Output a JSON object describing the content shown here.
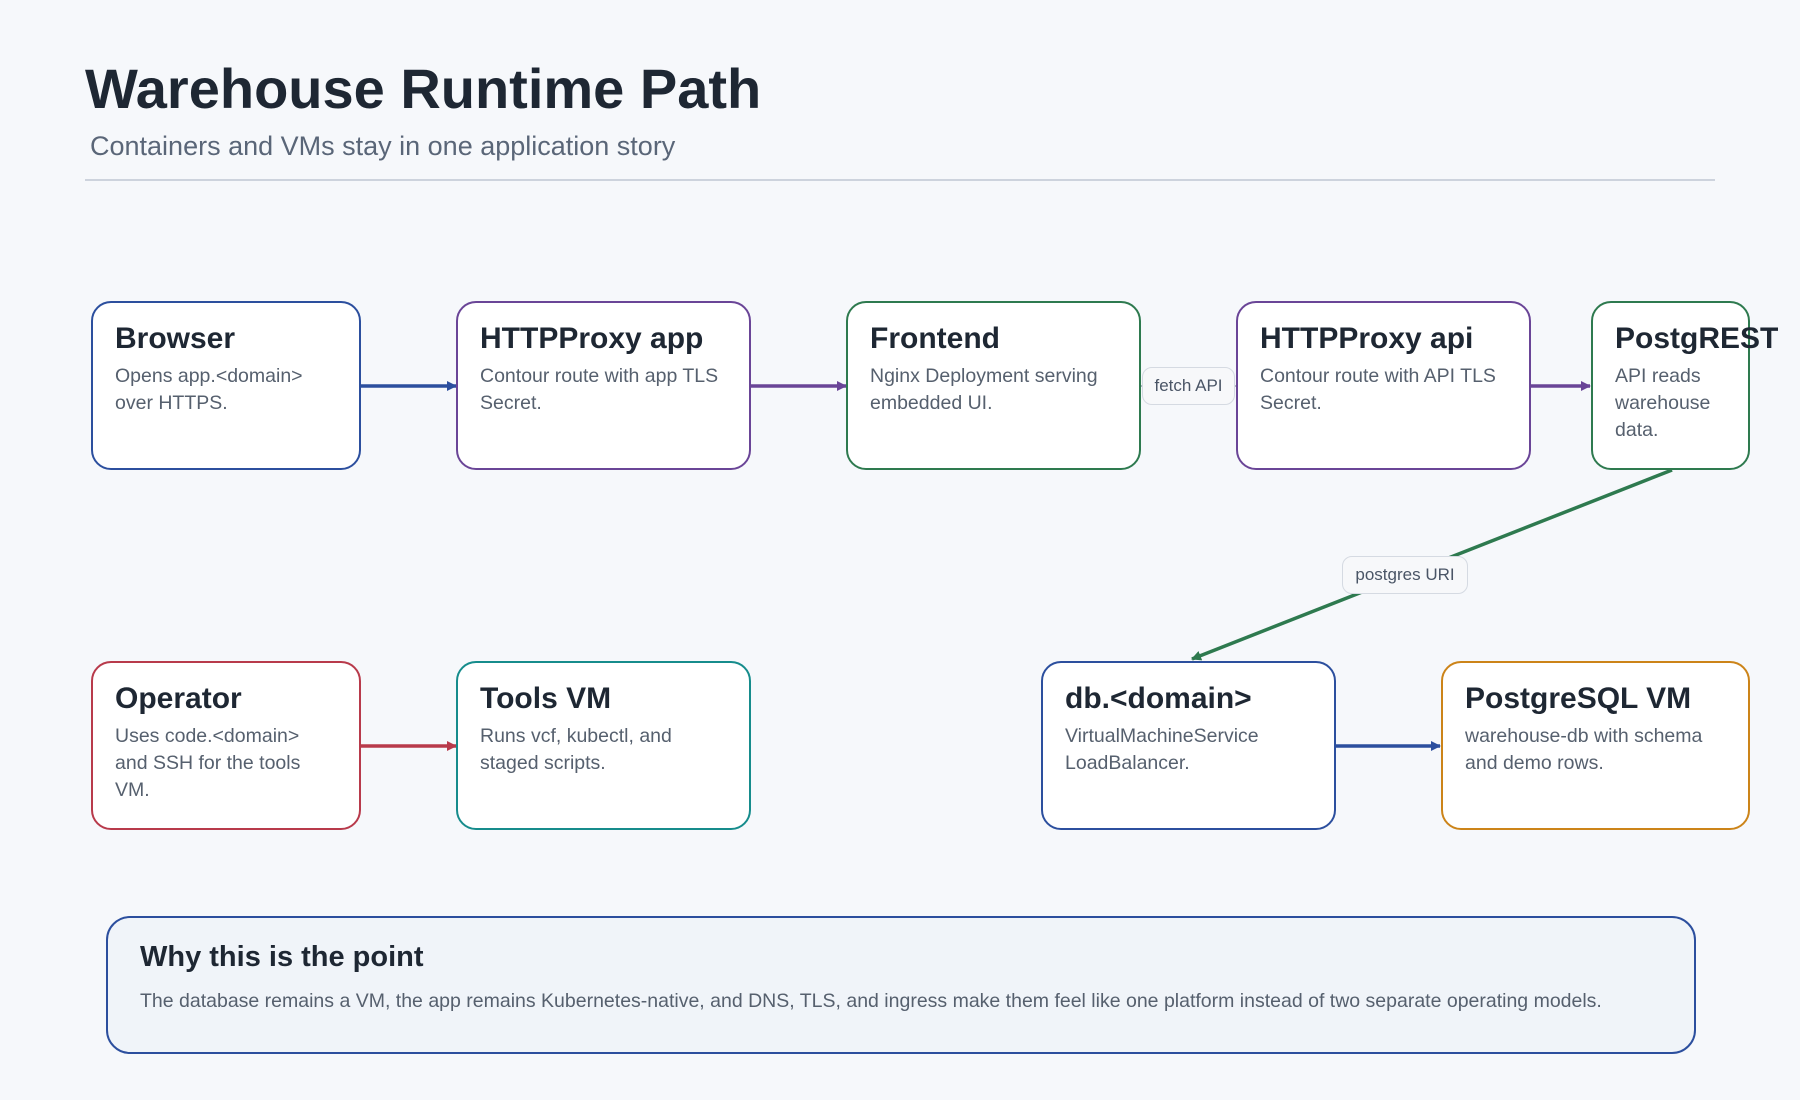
{
  "header": {
    "title": "Warehouse Runtime Path",
    "subtitle": "Containers and VMs stay in one application story"
  },
  "nodes": {
    "browser": {
      "title": "Browser",
      "desc": "Opens app.<domain> over HTTPS.",
      "color": "#2c4f9e"
    },
    "httpproxy_app": {
      "title": "HTTPProxy app",
      "desc": "Contour route with app TLS Secret.",
      "color": "#6a4597"
    },
    "frontend": {
      "title": "Frontend",
      "desc": "Nginx Deployment serving embedded UI.",
      "color": "#2e7a4f"
    },
    "httpproxy_api": {
      "title": "HTTPProxy api",
      "desc": "Contour route with API TLS Secret.",
      "color": "#6a4597"
    },
    "postgrest": {
      "title": "PostgREST",
      "desc": "API reads warehouse data.",
      "color": "#2e7a4f"
    },
    "operator": {
      "title": "Operator",
      "desc": "Uses code.<domain> and SSH for the tools VM.",
      "color": "#b83a4b"
    },
    "tools_vm": {
      "title": "Tools VM",
      "desc": "Runs vcf, kubectl, and staged scripts.",
      "color": "#168c8c"
    },
    "db_domain": {
      "title": "db.<domain>",
      "desc": "VirtualMachineService LoadBalancer.",
      "color": "#2c4f9e"
    },
    "postgresql_vm": {
      "title": "PostgreSQL VM",
      "desc": "warehouse-db with schema and demo rows.",
      "color": "#cc8419"
    }
  },
  "edges": {
    "fetch_api": "fetch API",
    "postgres_uri": "postgres URI",
    "colors": {
      "browser_to_app": "#2c4f9e",
      "app_to_frontend": "#6a4597",
      "api_to_postgrest": "#6a4597",
      "postgrest_to_db": "#2e7a4f",
      "operator_to_tools": "#b83a4b",
      "db_to_postgresql": "#2c4f9e"
    }
  },
  "callout": {
    "title": "Why this is the point",
    "text": "The database remains a VM, the app remains Kubernetes-native, and DNS, TLS, and ingress make them feel like one platform instead of two separate operating models.",
    "color": "#2c4f9e"
  }
}
